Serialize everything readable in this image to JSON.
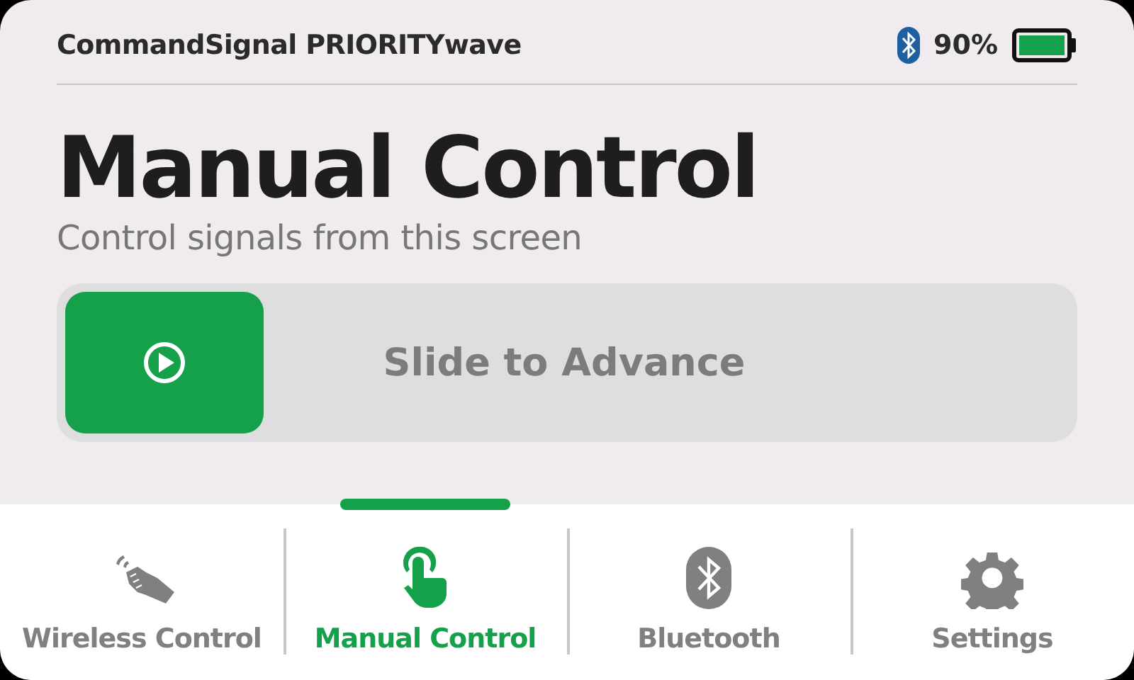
{
  "status_bar": {
    "title": "CommandSignal PRIORITYwave",
    "battery": "90%"
  },
  "header": {
    "title": "Manual Control",
    "subtitle": "Control signals from this screen"
  },
  "slider": {
    "label": "Slide to Advance",
    "level": 0
  },
  "nav": [
    {
      "label": "Wireless Control",
      "kind": "wireless",
      "selected": false
    },
    {
      "label": "Manual Control",
      "kind": "manual",
      "selected": true
    },
    {
      "label": "Bluetooth",
      "kind": "bluetooth",
      "selected": false
    },
    {
      "label": "Settings",
      "kind": "settings",
      "selected": false
    }
  ]
}
